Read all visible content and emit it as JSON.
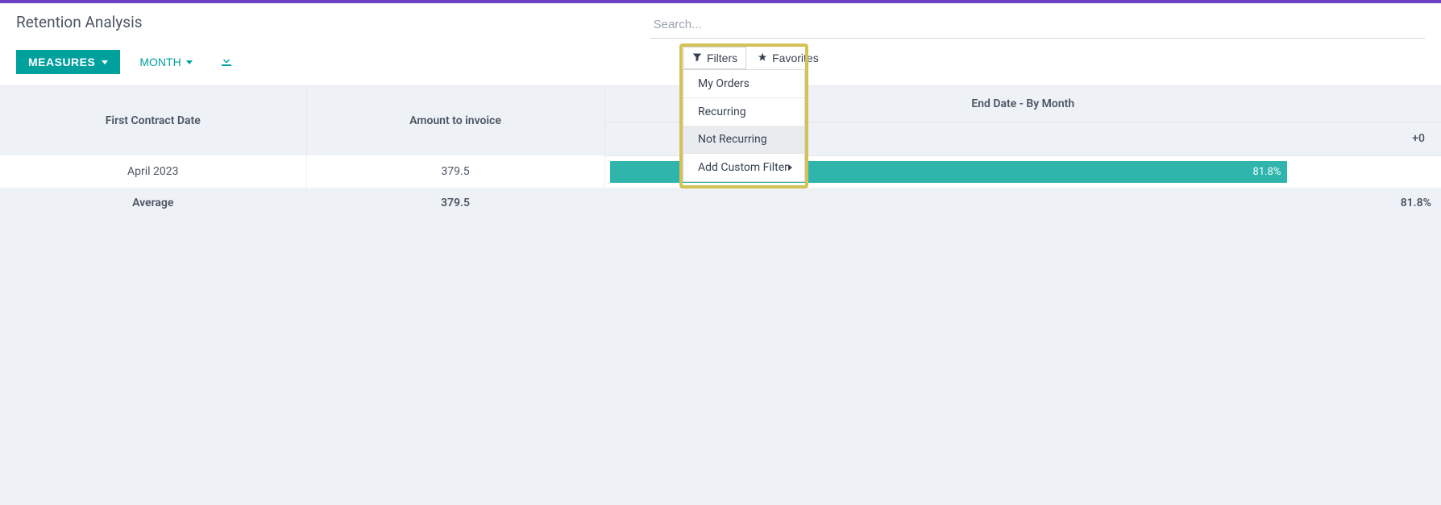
{
  "page": {
    "title": "Retention Analysis"
  },
  "search": {
    "placeholder": "Search..."
  },
  "toolbar": {
    "measures_label": "MEASURES",
    "month_label": "MONTH"
  },
  "filter_bar": {
    "filters_label": "Filters",
    "favorites_label": "Favorites"
  },
  "filter_menu": {
    "items": {
      "my_orders": "My Orders",
      "recurring": "Recurring",
      "not_recurring": "Not Recurring",
      "add_custom": "Add Custom Filter"
    }
  },
  "table": {
    "headers": {
      "contract_date": "First Contract Date",
      "amount_to_invoice": "Amount to invoice",
      "end_date": "End Date - By Month",
      "plus0": "+0"
    },
    "rows": [
      {
        "contract_date": "April 2023",
        "amount": "379.5",
        "pct": "81.8%"
      }
    ],
    "average": {
      "label": "Average",
      "amount": "379.5",
      "pct": "81.8%"
    }
  },
  "colors": {
    "primary": "#00a09d",
    "bar": "#2fb5ac",
    "header_bg": "#eef2f7",
    "highlight": "#d4c257"
  }
}
